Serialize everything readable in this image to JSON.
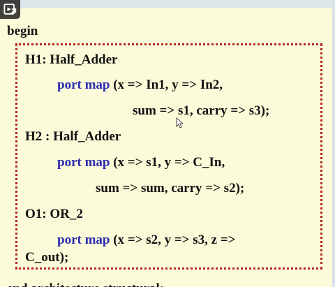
{
  "code": {
    "begin": "begin",
    "h1_label": "H1:  Half_Adder",
    "h1_port_kw": "port map",
    "h1_args_a": " (x => In1, y => In2,",
    "h1_args_b": "sum => s1, carry => s3);",
    "h2_label": "H2 :  Half_Adder",
    "h2_port_kw": "port map",
    "h2_args_a": " (x => s1, y => C_In,",
    "h2_args_b": "sum => sum, carry => s2);",
    "o1_label": "O1: OR_2",
    "o1_port_kw": "port map",
    "o1_args_a": " (x => s2, y => s3, z =>",
    "o1_args_b": "C_out);",
    "end": "end architecture structural;"
  },
  "colors": {
    "slide_background": "#fbfbd9",
    "keyword_blue": "#2c2bb0",
    "box_border_red": "#b3261e",
    "text": "#111111"
  },
  "icons": {
    "share": "share-icon",
    "cursor": "mouse-pointer-icon"
  }
}
